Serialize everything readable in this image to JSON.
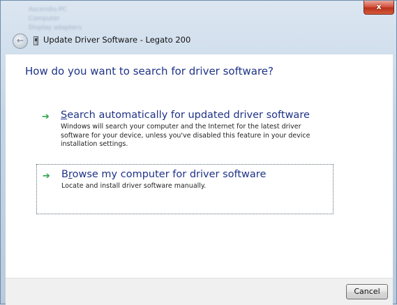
{
  "window": {
    "title": "Update Driver Software - Legato 200",
    "close_glyph": "x",
    "back_glyph": "←",
    "background_tree": [
      "Ascendis-PC",
      "Computer",
      "Display adapters"
    ]
  },
  "main": {
    "heading": "How do you want to search for driver software?",
    "options": [
      {
        "title_prefix": "",
        "title_mnemonic": "S",
        "title_rest": "earch automatically for updated driver software",
        "description": "Windows will search your computer and the Internet for the latest driver software for your device, unless you've disabled this feature in your device installation settings."
      },
      {
        "title_prefix": "B",
        "title_mnemonic": "r",
        "title_rest": "owse my computer for driver software",
        "description": "Locate and install driver software manually."
      }
    ],
    "option_arrow_glyph": "➔"
  },
  "footer": {
    "cancel_label": "Cancel"
  },
  "colors": {
    "heading": "#1e3287",
    "arrow": "#2ea24a",
    "close_button": "#c8432a"
  },
  "icons": [
    "back-arrow-icon",
    "device-icon",
    "close-icon",
    "green-arrow-icon"
  ]
}
